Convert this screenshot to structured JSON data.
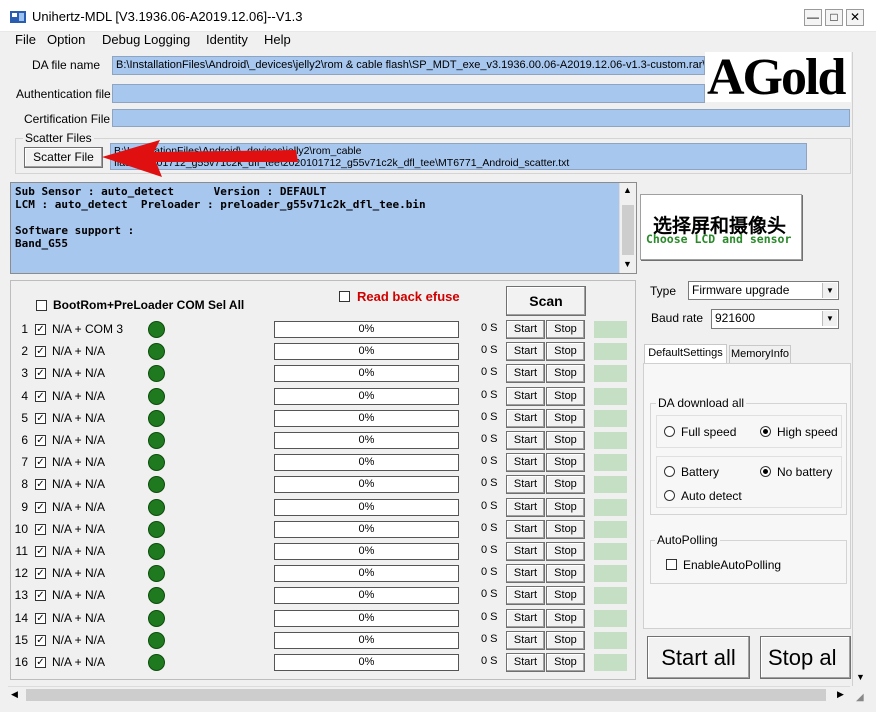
{
  "window": {
    "title": "Unihertz-MDL [V3.1936.06-A2019.12.06]--V1.3",
    "minimize": "—",
    "maximize": "□",
    "close": "✕"
  },
  "menu": [
    "File",
    "Option",
    "Debug Logging",
    "Identity",
    "Help"
  ],
  "files": {
    "da_label": "DA file name",
    "da_value": "B:\\InstallationFiles\\Android\\_devices\\jelly2\\rom & cable flash\\SP_MDT_exe_v3.1936.00.06-A2019.12.06-v1.3-custom.rar\\SP",
    "auth_label": "Authentication file",
    "auth_value": "",
    "cert_label": "Certification File",
    "cert_value": "",
    "scatter_group": "Scatter Files",
    "scatter_button": "Scatter File",
    "scatter_line1": "B:\\InstallationFiles\\Android\\_devices\\jelly2\\rom_cable",
    "scatter_line2": "flash\\20201712_g55v71c2k_dfl_tee\\2020101712_g55v71c2k_dfl_tee\\MT6771_Android_scatter.txt"
  },
  "logo": {
    "text": "AGold"
  },
  "log": {
    "text": "Sub Sensor : auto_detect      Version : DEFAULT\nLCM : auto_detect  Preloader : preloader_g55v71c2k_dfl_tee.bin\n\nSoftware support :\nBand_G55"
  },
  "choose": {
    "zh": "选择屏和摄像头",
    "en": "Choose LCD and sensor"
  },
  "ports": {
    "select_all": "BootRom+PreLoader COM Sel All",
    "read_back": "Read back efuse",
    "scan": "Scan",
    "start_label": "Start",
    "stop_label": "Stop",
    "rows": [
      {
        "num": "1",
        "port": "N/A + COM 3",
        "progress": "0%",
        "time": "0 S"
      },
      {
        "num": "2",
        "port": "N/A + N/A",
        "progress": "0%",
        "time": "0 S"
      },
      {
        "num": "3",
        "port": "N/A + N/A",
        "progress": "0%",
        "time": "0 S"
      },
      {
        "num": "4",
        "port": "N/A + N/A",
        "progress": "0%",
        "time": "0 S"
      },
      {
        "num": "5",
        "port": "N/A + N/A",
        "progress": "0%",
        "time": "0 S"
      },
      {
        "num": "6",
        "port": "N/A + N/A",
        "progress": "0%",
        "time": "0 S"
      },
      {
        "num": "7",
        "port": "N/A + N/A",
        "progress": "0%",
        "time": "0 S"
      },
      {
        "num": "8",
        "port": "N/A + N/A",
        "progress": "0%",
        "time": "0 S"
      },
      {
        "num": "9",
        "port": "N/A + N/A",
        "progress": "0%",
        "time": "0 S"
      },
      {
        "num": "10",
        "port": "N/A + N/A",
        "progress": "0%",
        "time": "0 S"
      },
      {
        "num": "11",
        "port": "N/A + N/A",
        "progress": "0%",
        "time": "0 S"
      },
      {
        "num": "12",
        "port": "N/A + N/A",
        "progress": "0%",
        "time": "0 S"
      },
      {
        "num": "13",
        "port": "N/A + N/A",
        "progress": "0%",
        "time": "0 S"
      },
      {
        "num": "14",
        "port": "N/A + N/A",
        "progress": "0%",
        "time": "0 S"
      },
      {
        "num": "15",
        "port": "N/A + N/A",
        "progress": "0%",
        "time": "0 S"
      },
      {
        "num": "16",
        "port": "N/A + N/A",
        "progress": "0%",
        "time": "0 S"
      }
    ]
  },
  "settings": {
    "type_label": "Type",
    "type_value": "Firmware upgrade",
    "baud_label": "Baud rate",
    "baud_value": "921600",
    "tab_default": "DefaultSettings",
    "tab_memory": "MemoryInfo",
    "da_group": "DA download all",
    "full_speed": "Full speed",
    "high_speed": "High speed",
    "battery": "Battery",
    "no_battery": "No battery",
    "auto_detect": "Auto detect",
    "autopolling_group": "AutoPolling",
    "enable_autopolling": "EnableAutoPolling"
  },
  "actions": {
    "start_all": "Start all",
    "stop_all": "Stop al"
  },
  "colors": {
    "accent_field": "#a7c7ef",
    "status_green": "#1f7a1f",
    "arrow_red": "#e01010",
    "efuse_red": "#d00000"
  }
}
